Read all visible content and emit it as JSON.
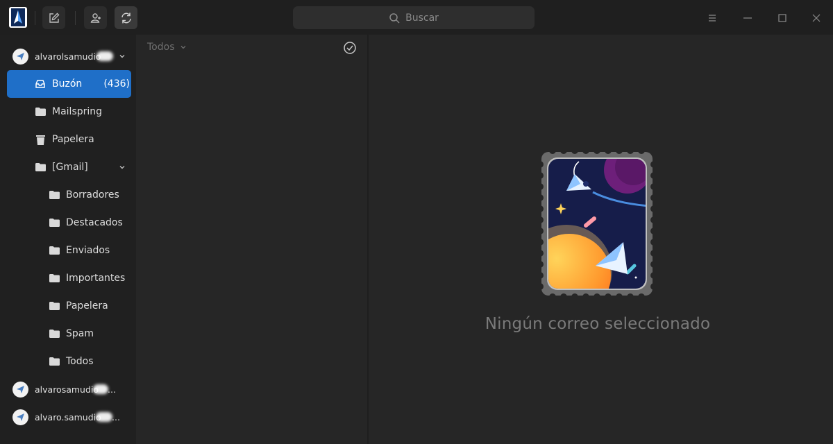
{
  "toolbar": {
    "app_logo": "mailspring-logo-icon",
    "compose_icon": "compose-icon",
    "contacts_icon": "contacts-icon",
    "sync_icon": "sync-icon"
  },
  "search": {
    "placeholder": "Buscar"
  },
  "window_controls": [
    "menu-icon",
    "minimize-icon",
    "maximize-icon",
    "close-icon"
  ],
  "sidebar": {
    "accounts": [
      {
        "name": "alvarolsamudio",
        "expanded": true,
        "folders": [
          {
            "label": "Buzón",
            "count": "(436)",
            "icon": "inbox-icon",
            "selected": true
          },
          {
            "label": "Mailspring",
            "icon": "folder-icon"
          },
          {
            "label": "Papelera",
            "icon": "trash-icon"
          },
          {
            "label": "[Gmail]",
            "icon": "folder-icon",
            "expanded": true,
            "children": [
              {
                "label": "Borradores",
                "icon": "folder-icon"
              },
              {
                "label": "Destacados",
                "icon": "folder-icon"
              },
              {
                "label": "Enviados",
                "icon": "folder-icon"
              },
              {
                "label": "Importantes",
                "icon": "folder-icon"
              },
              {
                "label": "Papelera",
                "icon": "folder-icon"
              },
              {
                "label": "Spam",
                "icon": "folder-icon"
              },
              {
                "label": "Todos",
                "icon": "folder-icon"
              }
            ]
          }
        ]
      },
      {
        "name": "alvarosamudio",
        "suffix": "..."
      },
      {
        "name": "alvaro.samudio",
        "suffix": "..."
      }
    ]
  },
  "list": {
    "filter_label": "Todos"
  },
  "reading_pane": {
    "empty_message": "Ningún correo seleccionado"
  },
  "colors": {
    "accent": "#1f6fc8",
    "background": "#262626",
    "sidebar": "#202020",
    "titlebar": "#1f1f1f"
  }
}
